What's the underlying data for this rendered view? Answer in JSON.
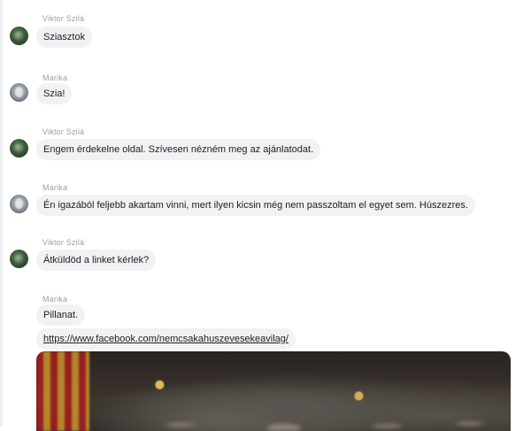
{
  "messages": [
    {
      "sender": "Viktor Szilá",
      "avatar": "viktor-avatar",
      "text": "Sziasztok"
    },
    {
      "sender": "Marika",
      "avatar": "marika-avatar",
      "text": "Szia!"
    },
    {
      "sender": "Viktor Szilá",
      "avatar": "viktor-avatar",
      "text": "Engem érdekelne oldal. Szívesen nézném meg az ajánlatodat."
    },
    {
      "sender": "Marika",
      "avatar": "marika-avatar",
      "text": "Én igazából feljebb akartam vinni, mert ilyen kicsin még nem passzoltam el egyet sem. Húszezres."
    },
    {
      "sender": "Viktor Szilá",
      "avatar": "viktor-avatar",
      "text": "Átküldöd a linket kérlek?"
    },
    {
      "sender": "Marika",
      "avatar": "marika-avatar",
      "text": "Pillanat.",
      "link": "https://www.facebook.com/nemcsakahuszevesekeavilag/"
    }
  ],
  "media": {
    "description_icon": "photo-crowd-image"
  }
}
